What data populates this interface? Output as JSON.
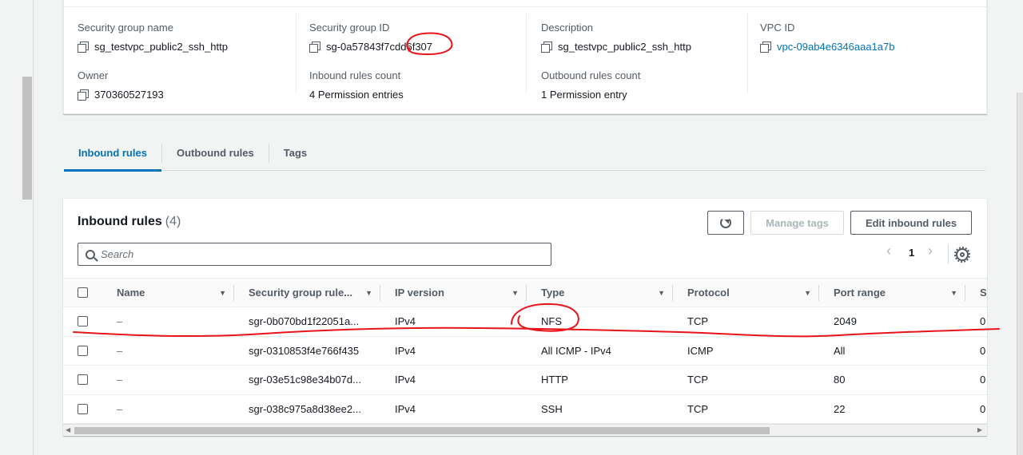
{
  "details": {
    "group_name_label": "Security group name",
    "group_name": "sg_testvpc_public2_ssh_http",
    "group_id_label": "Security group ID",
    "group_id": "sg-0a57843f7cdd6f307",
    "description_label": "Description",
    "description": "sg_testvpc_public2_ssh_http",
    "vpc_label": "VPC ID",
    "vpc_id": "vpc-09ab4e6346aaa1a7b",
    "owner_label": "Owner",
    "owner": "370360527193",
    "inbound_count_label": "Inbound rules count",
    "inbound_count": "4 Permission entries",
    "outbound_count_label": "Outbound rules count",
    "outbound_count": "1 Permission entry"
  },
  "tabs": [
    "Inbound rules",
    "Outbound rules",
    "Tags"
  ],
  "rules": {
    "title": "Inbound rules",
    "count": "(4)",
    "manage_tags": "Manage tags",
    "edit_button": "Edit inbound rules",
    "search_placeholder": "Search",
    "page": "1",
    "prev_glyph": "‹",
    "next_glyph": "›",
    "columns": [
      "Name",
      "Security group rule...",
      "IP version",
      "Type",
      "Protocol",
      "Port range",
      "S"
    ],
    "rows": [
      {
        "name": "–",
        "rule_id": "sgr-0b070bd1f22051a...",
        "ip": "IPv4",
        "type": "NFS",
        "protocol": "TCP",
        "port": "2049",
        "src": "0"
      },
      {
        "name": "–",
        "rule_id": "sgr-0310853f4e766f435",
        "ip": "IPv4",
        "type": "All ICMP - IPv4",
        "protocol": "ICMP",
        "port": "All",
        "src": "0"
      },
      {
        "name": "–",
        "rule_id": "sgr-03e51c98e34b07d...",
        "ip": "IPv4",
        "type": "HTTP",
        "protocol": "TCP",
        "port": "80",
        "src": "0"
      },
      {
        "name": "–",
        "rule_id": "sgr-038c975a8d38ee2...",
        "ip": "IPv4",
        "type": "SSH",
        "protocol": "TCP",
        "port": "22",
        "src": "0"
      }
    ]
  },
  "colors": {
    "accent": "#0073bb",
    "annotation": "#e8141a"
  },
  "icons": [
    "copy-icon",
    "refresh-icon",
    "search-icon",
    "gear-icon",
    "caret-down-icon"
  ]
}
